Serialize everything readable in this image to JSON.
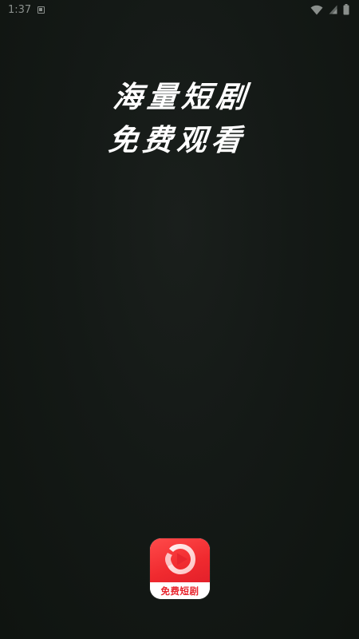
{
  "status_bar": {
    "time": "1:37",
    "notification_icon": "app-notification-icon",
    "wifi_icon": "wifi-icon",
    "signal_icon": "signal-icon",
    "battery_icon": "battery-icon"
  },
  "splash": {
    "slogan_line_1": "海量短剧",
    "slogan_line_2": "免费观看"
  },
  "app_logo": {
    "icon": "play-icon",
    "label": "免费短剧",
    "brand_color": "#f02a2f"
  },
  "colors": {
    "background": "#121714",
    "text": "#ffffff",
    "status_text": "#8a8f8c"
  }
}
